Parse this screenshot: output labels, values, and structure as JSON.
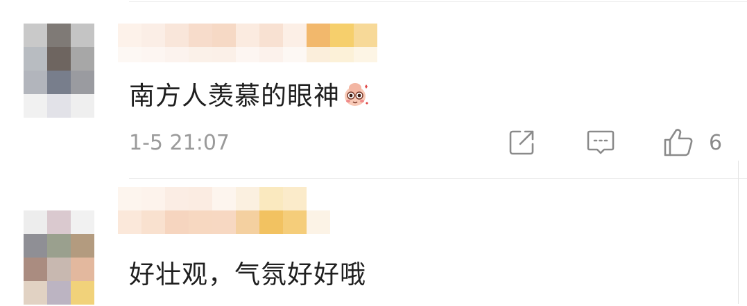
{
  "comments": [
    {
      "text": "南方人羡慕的眼神",
      "emoji": "blushing-emoji-icon",
      "time": "1-5 21:07",
      "likes": "6",
      "actions": [
        "share-icon",
        "reply-icon",
        "like-icon"
      ]
    },
    {
      "text": "好壮观，气氛好好哦"
    }
  ],
  "colors": {
    "text": "#1f1f1f",
    "meta": "#9a9a9a",
    "icon": "#8a8a8a",
    "divider": "#e6e6e6"
  }
}
